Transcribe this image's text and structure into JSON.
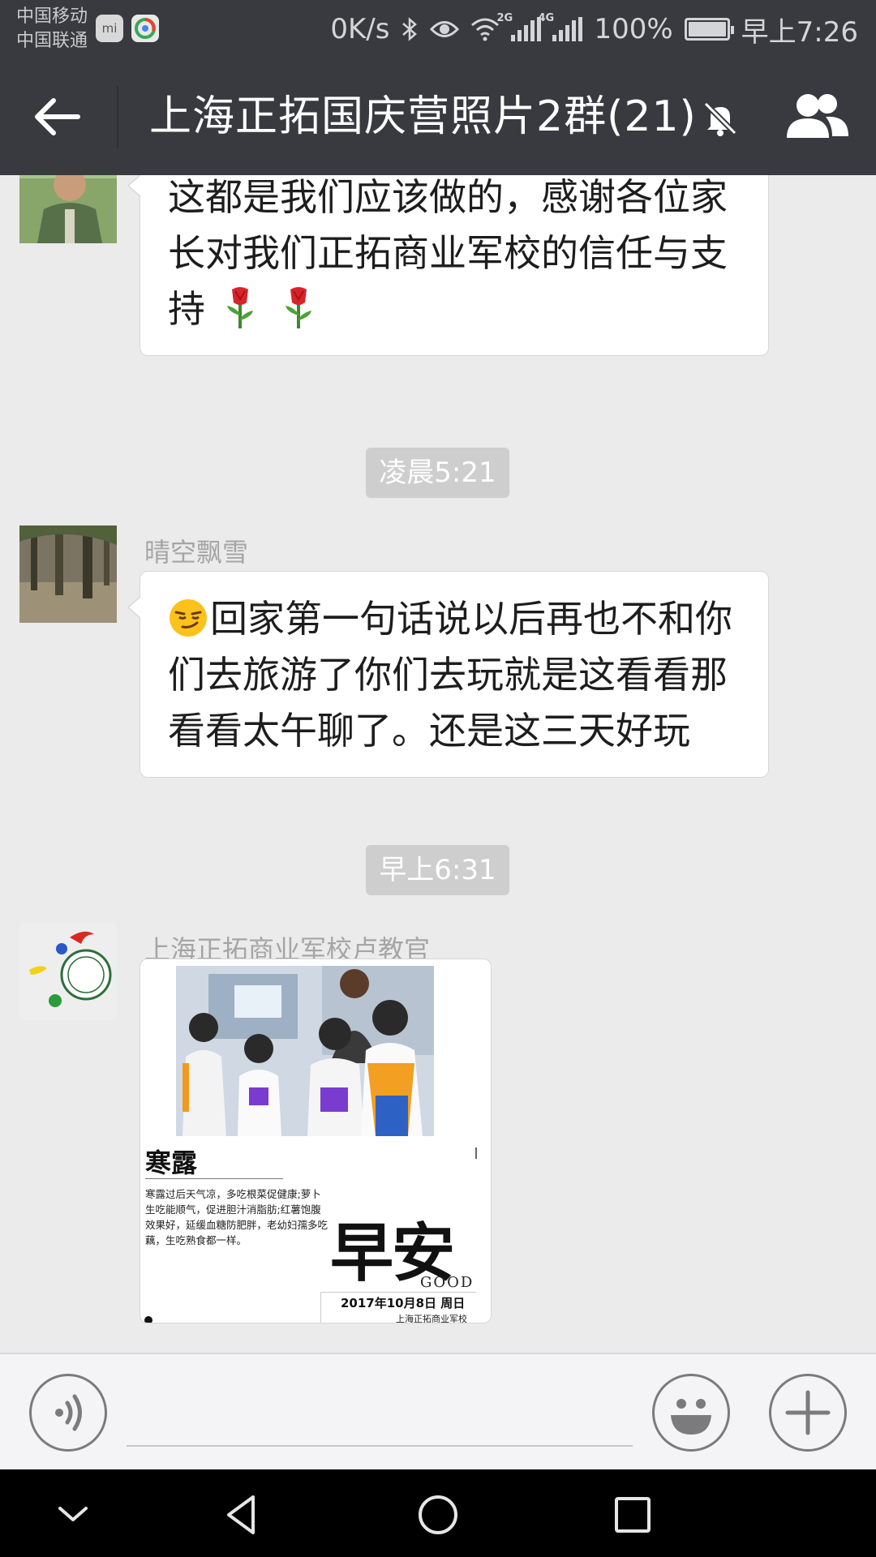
{
  "status_bar": {
    "carrier_1": "中国移动",
    "carrier_2": "中国联通",
    "app_icon_1": "mi",
    "speed": "0K/s",
    "net_tag_1": "2G",
    "net_tag_2": "4G",
    "battery": "100%",
    "time": "早上7:26",
    "icons": [
      "bluetooth-icon",
      "eye-icon",
      "wifi-icon",
      "signal-icon",
      "signal-icon",
      "battery-icon"
    ]
  },
  "header": {
    "title": "上海正拓国庆营照片2群(21)",
    "icons": [
      "back-arrow-icon",
      "mute-bell-icon",
      "group-members-icon"
    ],
    "background": "#393a3f"
  },
  "messages": [
    {
      "type": "text",
      "text": "这都是我们应该做的，感谢各位家长对我们正拓商业军校的信任与支持",
      "emoji": [
        "rose-emoji",
        "rose-emoji"
      ]
    },
    {
      "type": "time",
      "text": "凌晨5:21"
    },
    {
      "type": "text",
      "sender": "晴空飘雪",
      "emoji_prefix": "smirk-emoji",
      "text": "回家第一句话说以后再也不和你们去旅游了你们去玩就是这看看那看看太午聊了。还是这三天好玩"
    },
    {
      "type": "time",
      "text": "早上6:31"
    },
    {
      "type": "image",
      "sender": "上海正拓商业军校卢教官",
      "image": {
        "subtitle": "寒露",
        "body": "寒露过后天气凉，多吃根菜促健康;萝卜生吃能顺气，促进胆汁消脂肪;红薯饱腹效果好，延缓血糖防肥胖，老幼妇孺多吃藕，生吃熟食都一样。",
        "headline": "早安",
        "good": "GOOD",
        "date": "2017年10月8日 周日",
        "school": "上海正拓商业军校"
      }
    }
  ],
  "input_bar": {
    "placeholder": "",
    "icons": [
      "voice-icon",
      "emoji-icon",
      "plus-icon"
    ]
  },
  "nav_bar": {
    "icons": [
      "collapse-chevron-icon",
      "back-triangle-icon",
      "home-circle-icon",
      "recents-square-icon"
    ]
  },
  "colors": {
    "bar": "#393a3f",
    "chat_background": "#ebebeb",
    "bubble": "#ffffff",
    "time_badge": "#cecece"
  }
}
